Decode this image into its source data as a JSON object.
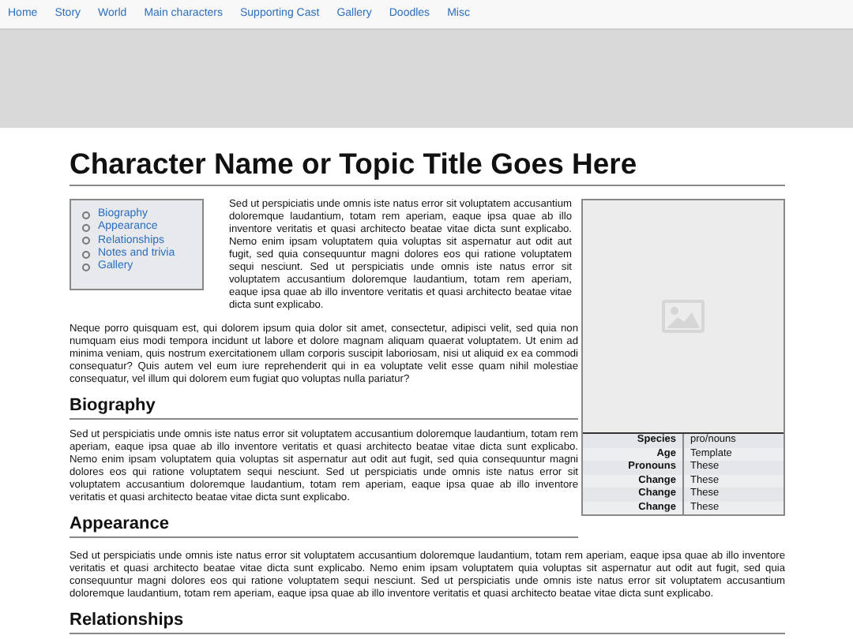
{
  "nav": [
    "Home",
    "Story",
    "World",
    "Main characters",
    "Supporting Cast",
    "Gallery",
    "Doodles",
    "Misc"
  ],
  "title": "Character Name or Topic Title Goes Here",
  "toc": [
    "Biography",
    "Appearance",
    "Relationships",
    "Notes and trivia",
    "Gallery"
  ],
  "infobox": {
    "rows": [
      {
        "label": "Species",
        "value": "pro/nouns"
      },
      {
        "label": "Age",
        "value": "Template"
      },
      {
        "label": "Pronouns",
        "value": "These"
      },
      {
        "label": "Change",
        "value": "These"
      },
      {
        "label": "Change",
        "value": "These"
      },
      {
        "label": "Change",
        "value": "These"
      }
    ]
  },
  "intro": [
    "Sed ut perspiciatis unde omnis iste natus error sit voluptatem accusantium doloremque laudantium, totam rem aperiam, eaque ipsa quae ab illo inventore veritatis et quasi architecto beatae vitae dicta sunt explicabo. Nemo enim ipsam voluptatem quia voluptas sit aspernatur aut odit aut fugit, sed quia consequuntur magni dolores eos qui ratione voluptatem sequi nesciunt. Sed ut perspiciatis unde omnis iste natus error sit voluptatem accusantium doloremque laudantium, totam rem aperiam, eaque ipsa quae ab illo inventore veritatis et quasi architecto beatae vitae dicta sunt explicabo.",
    "Neque porro quisquam est, qui dolorem ipsum quia dolor sit amet, consectetur, adipisci velit, sed quia non numquam eius modi tempora incidunt ut labore et dolore magnam aliquam quaerat voluptatem. Ut enim ad minima veniam, quis nostrum exercitationem ullam corporis suscipit laboriosam, nisi ut aliquid ex ea commodi consequatur? Quis autem vel eum iure reprehenderit qui in ea voluptate velit esse quam nihil molestiae consequatur, vel illum qui dolorem eum fugiat quo voluptas nulla pariatur?"
  ],
  "sections": [
    {
      "heading": "Biography",
      "text": "Sed ut perspiciatis unde omnis iste natus error sit voluptatem accusantium doloremque laudantium, totam rem aperiam, eaque ipsa quae ab illo inventore veritatis et quasi architecto beatae vitae dicta sunt explicabo. Nemo enim ipsam voluptatem quia voluptas sit aspernatur aut odit aut fugit, sed quia consequuntur magni dolores eos qui ratione voluptatem sequi nesciunt. Sed ut perspiciatis unde omnis iste natus error sit voluptatem accusantium doloremque laudantium, totam rem aperiam, eaque ipsa quae ab illo inventore veritatis et quasi architecto beatae vitae dicta sunt explicabo."
    },
    {
      "heading": "Appearance",
      "text": "Sed ut perspiciatis unde omnis iste natus error sit voluptatem accusantium doloremque laudantium, totam rem aperiam, eaque ipsa quae ab illo inventore veritatis et quasi architecto beatae vitae dicta sunt explicabo. Nemo enim ipsam voluptatem quia voluptas sit aspernatur aut odit aut fugit, sed quia consequuntur magni dolores eos qui ratione voluptatem sequi nesciunt. Sed ut perspiciatis unde omnis iste natus error sit voluptatem accusantium doloremque laudantium, totam rem aperiam, eaque ipsa quae ab illo inventore veritatis et quasi architecto beatae vitae dicta sunt explicabo."
    },
    {
      "heading": "Relationships"
    }
  ]
}
